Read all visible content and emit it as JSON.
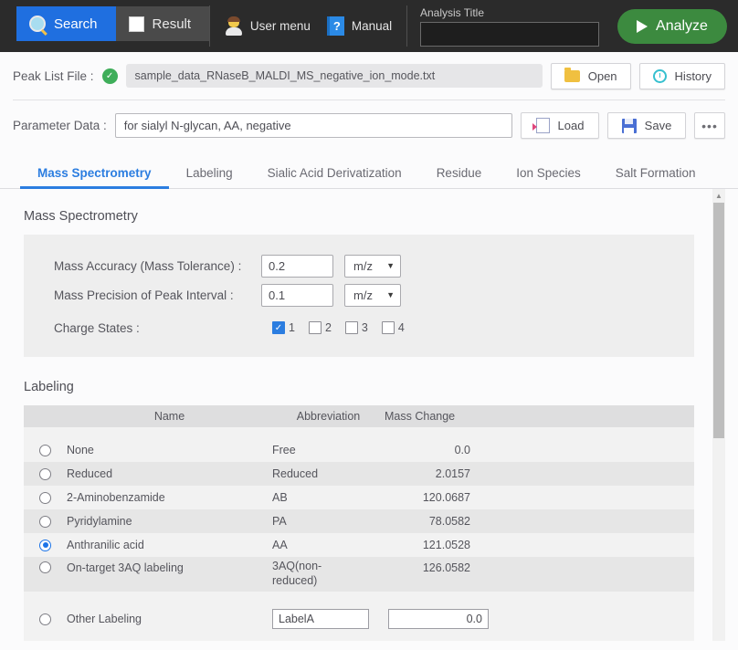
{
  "topbar": {
    "nav": [
      {
        "label": "Search",
        "icon": "search-icon",
        "active": true
      },
      {
        "label": "Result",
        "icon": "grid-icon",
        "active": false
      }
    ],
    "tools": [
      {
        "label": "User menu",
        "icon": "user-icon"
      },
      {
        "label": "Manual",
        "icon": "book-question-icon"
      }
    ],
    "analysis_title_label": "Analysis Title",
    "analysis_title_value": "",
    "analysis_title_placeholder": "",
    "analyze_label": "Analyze",
    "accent_blue": "#1f6fe0",
    "accent_green": "#3c8a3f"
  },
  "file_row": {
    "label": "Peak List File :",
    "status": "valid",
    "file_name": "sample_data_RNaseB_MALDI_MS_negative_ion_mode.txt",
    "open_label": "Open",
    "history_label": "History"
  },
  "param_row": {
    "label": "Parameter Data :",
    "value": "for sialyl N-glycan, AA, negative",
    "load_label": "Load",
    "save_label": "Save",
    "more_label": "•••"
  },
  "tabs": [
    {
      "label": "Mass Spectrometry",
      "active": true
    },
    {
      "label": "Labeling",
      "active": false
    },
    {
      "label": "Sialic Acid Derivatization",
      "active": false
    },
    {
      "label": "Residue",
      "active": false
    },
    {
      "label": "Ion Species",
      "active": false
    },
    {
      "label": "Salt Formation",
      "active": false
    }
  ],
  "mass_spectrometry": {
    "section_title": "Mass Spectrometry",
    "mass_accuracy": {
      "label": "Mass Accuracy (Mass Tolerance) :",
      "value": "0.2",
      "unit": "m/z"
    },
    "mass_precision": {
      "label": "Mass Precision of Peak Interval :",
      "value": "0.1",
      "unit": "m/z"
    },
    "charge_states": {
      "label": "Charge States :",
      "options": [
        {
          "label": "1",
          "checked": true
        },
        {
          "label": "2",
          "checked": false
        },
        {
          "label": "3",
          "checked": false
        },
        {
          "label": "4",
          "checked": false
        }
      ]
    }
  },
  "labeling": {
    "section_title": "Labeling",
    "columns": [
      "Name",
      "Abbreviation",
      "Mass Change"
    ],
    "rows": [
      {
        "name": "None",
        "abbr": "Free",
        "mass": "0.0",
        "selected": false
      },
      {
        "name": "Reduced",
        "abbr": "Reduced",
        "mass": "2.0157",
        "selected": false
      },
      {
        "name": "2-Aminobenzamide",
        "abbr": "AB",
        "mass": "120.0687",
        "selected": false
      },
      {
        "name": "Pyridylamine",
        "abbr": "PA",
        "mass": "78.0582",
        "selected": false
      },
      {
        "name": "Anthranilic acid",
        "abbr": "AA",
        "mass": "121.0528",
        "selected": true
      },
      {
        "name": "On-target 3AQ labeling",
        "abbr": "3AQ(non-reduced)",
        "mass": "126.0582",
        "selected": false
      }
    ],
    "other": {
      "name": "Other Labeling",
      "abbr_value": "LabelA",
      "mass_value": "0.0",
      "selected": false
    }
  }
}
